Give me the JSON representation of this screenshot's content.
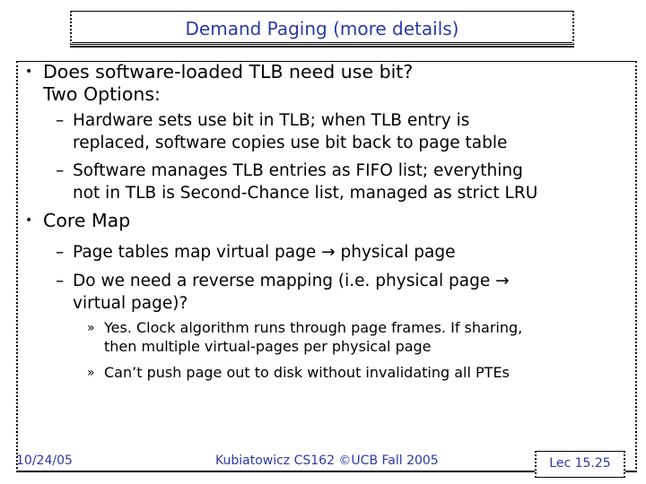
{
  "slide": {
    "title": "Demand Paging (more details)",
    "bullets": [
      {
        "marker": "•",
        "lines": [
          "Does software-loaded TLB need use bit?",
          "Two Options:"
        ],
        "sub": [
          {
            "marker": "–",
            "lines": [
              "Hardware sets use bit in TLB; when TLB entry is",
              "replaced, software copies use bit back to page table"
            ]
          },
          {
            "marker": "–",
            "lines": [
              "Software manages TLB entries as FIFO list; everything",
              "not in TLB is Second-Chance list, managed as strict LRU"
            ]
          }
        ]
      },
      {
        "marker": "•",
        "lines": [
          "Core Map"
        ],
        "sub": [
          {
            "marker": "–",
            "lines": [
              "Page tables map virtual page → physical page"
            ]
          },
          {
            "marker": "–",
            "lines": [
              "Do we need a reverse mapping (i.e. physical page →",
              "virtual page)?"
            ],
            "sub": [
              {
                "marker": "»",
                "lines": [
                  "Yes. Clock algorithm runs through page frames. If sharing,",
                  "then multiple virtual-pages per physical page"
                ]
              },
              {
                "marker": "»",
                "lines": [
                  "Can’t push page out to disk without invalidating all PTEs"
                ]
              }
            ]
          }
        ]
      }
    ]
  },
  "footer": {
    "date": "10/24/05",
    "center": "Kubiatowicz CS162 ©UCB Fall 2005",
    "slide_number": "Lec 15.25"
  },
  "colors": {
    "title": "#2a3aa8",
    "footer": "#2a3aa8",
    "text": "#000000"
  }
}
